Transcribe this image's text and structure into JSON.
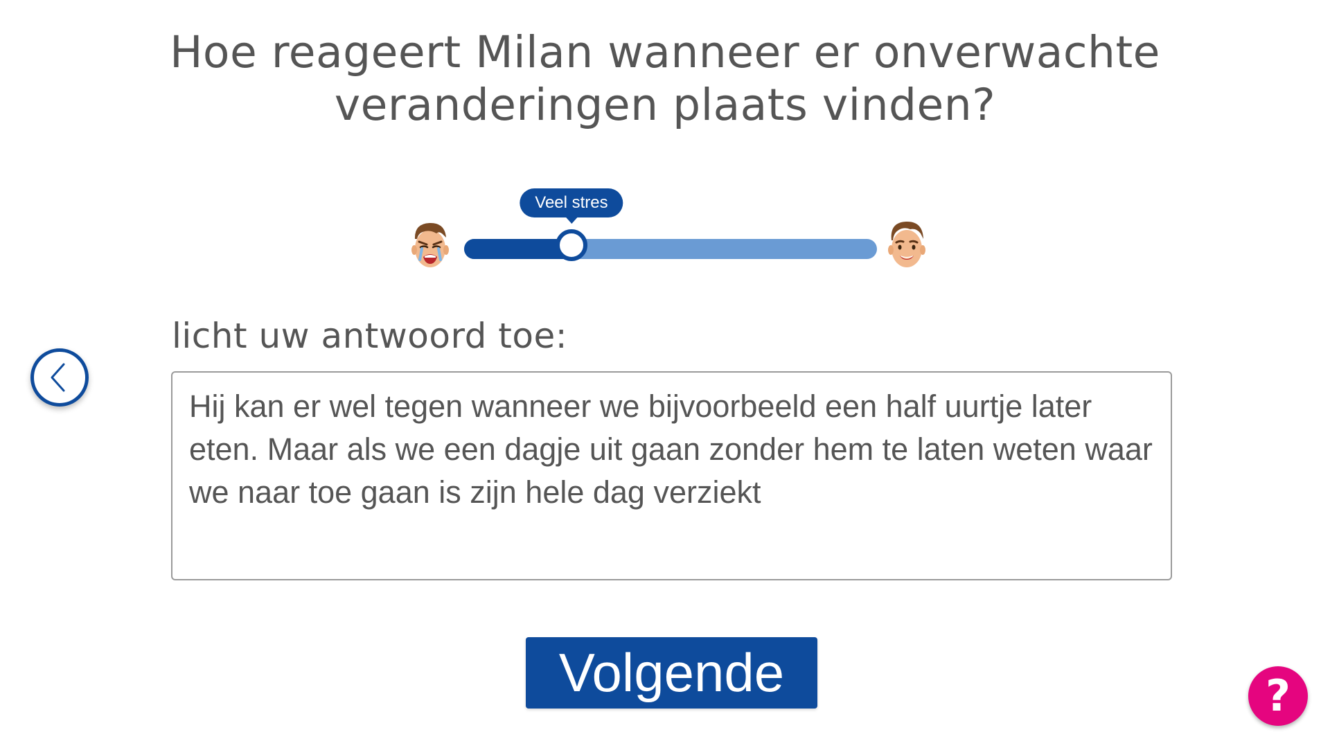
{
  "question": {
    "line1": "Hoe reageert Milan wanneer er onverwachte",
    "line2": "veranderingen plaats vinden?"
  },
  "slider": {
    "value_label": "Veel stres",
    "value_fraction": 0.26,
    "min_icon": "crying-face-icon",
    "max_icon": "smiling-face-icon",
    "fill_color": "#0e4b9c",
    "track_color": "#6a9bd4"
  },
  "answer": {
    "label": "licht uw antwoord toe:",
    "text": "Hij kan er wel tegen wanneer we bijvoorbeeld een half uurtje later eten. Maar als we een dagje uit gaan zonder hem te laten weten waar we naar toe gaan is zijn hele dag verziekt"
  },
  "navigation": {
    "back_icon": "chevron-left-icon",
    "next_label": "Volgende",
    "help_label": "?",
    "help_color": "#e5057f",
    "primary_color": "#0e4b9c"
  }
}
